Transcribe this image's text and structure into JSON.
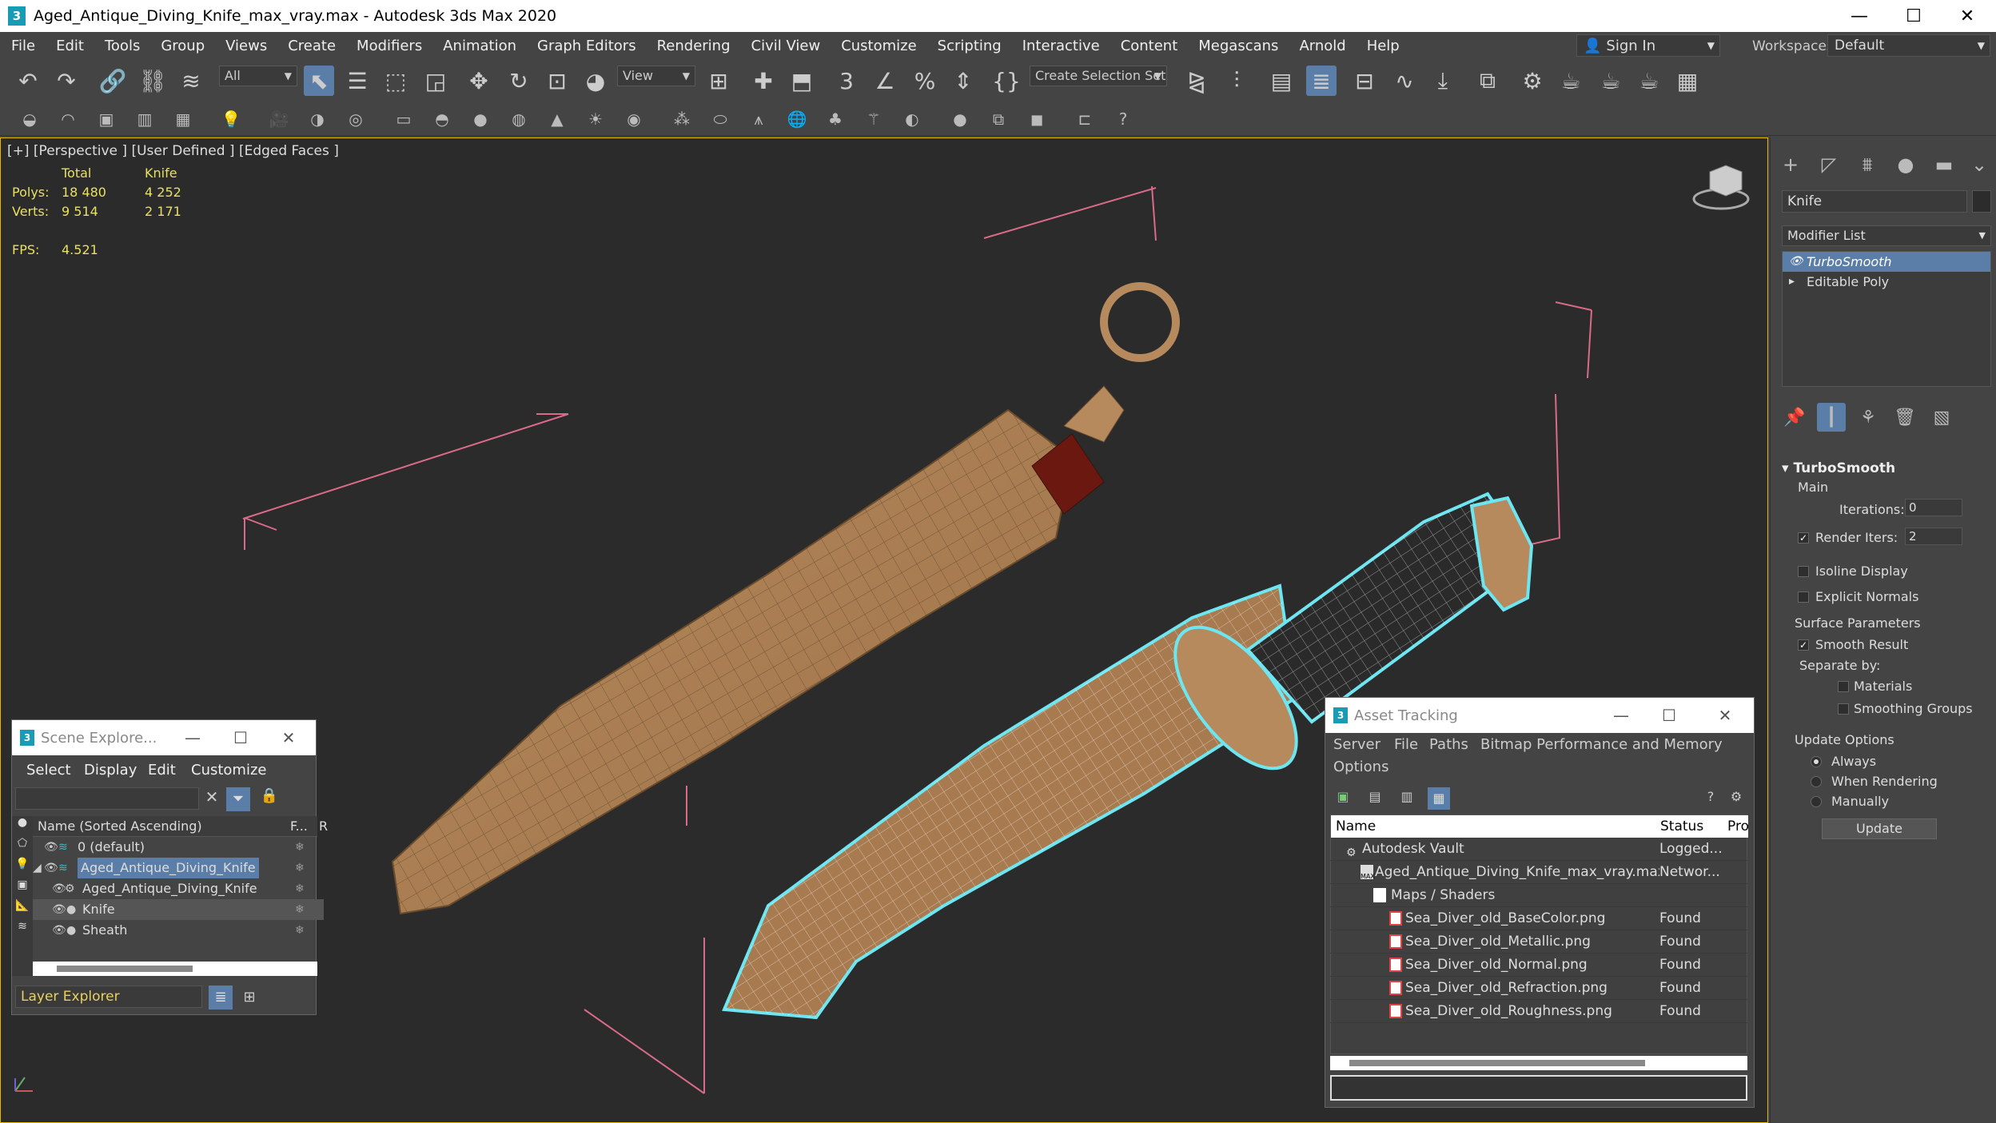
{
  "window": {
    "title": "Aged_Antique_Diving_Knife_max_vray.max - Autodesk 3ds Max 2020",
    "logo": "3",
    "minimize": "—",
    "maximize": "☐",
    "close": "✕"
  },
  "menu": [
    "File",
    "Edit",
    "Tools",
    "Group",
    "Views",
    "Create",
    "Modifiers",
    "Animation",
    "Graph Editors",
    "Rendering",
    "Civil View",
    "Customize",
    "Scripting",
    "Interactive",
    "Content",
    "Megascans",
    "Arnold",
    "Help"
  ],
  "signin": {
    "label": "Sign In",
    "icon": "user-icon"
  },
  "workspaces": {
    "label": "Workspaces:",
    "value": "Default"
  },
  "toolbar": {
    "filter_value": "All",
    "view_value": "View",
    "selection_set": "Create Selection Set"
  },
  "viewport": {
    "label": "[+] [Perspective ] [User Defined ] [Edged Faces ]",
    "stats": {
      "col_total": "Total",
      "col_knife": "Knife",
      "polys_label": "Polys:",
      "polys_total": "18 480",
      "polys_knife": "4 252",
      "verts_label": "Verts:",
      "verts_total": "9 514",
      "verts_knife": "2 171",
      "fps_label": "FPS:",
      "fps_value": "4.521"
    }
  },
  "command_panel": {
    "object_name": "Knife",
    "modifier_list": "Modifier List",
    "stack": [
      "TurboSmooth",
      "Editable Poly"
    ],
    "rollout": "TurboSmooth",
    "main": "Main",
    "iterations_label": "Iterations:",
    "iterations_value": "0",
    "render_iters_label": "Render Iters:",
    "render_iters_value": "2",
    "isoline": "Isoline Display",
    "explicit_normals": "Explicit Normals",
    "surface_params": "Surface Parameters",
    "smooth_result": "Smooth Result",
    "separate_by": "Separate by:",
    "materials": "Materials",
    "smoothing_groups": "Smoothing Groups",
    "update_options": "Update Options",
    "always": "Always",
    "when_rendering": "When Rendering",
    "manually": "Manually",
    "update_button": "Update"
  },
  "scene_explorer": {
    "title": "Scene Explore...",
    "menu": [
      "Select",
      "Display",
      "Edit",
      "Customize"
    ],
    "col_name": "Name (Sorted Ascending)",
    "col_f": "F...",
    "col_r": "R",
    "rows": [
      "0 (default)",
      "Aged_Antique_Diving_Knife",
      "Aged_Antique_Diving_Knife",
      "Knife",
      "Sheath"
    ],
    "footer": "Layer Explorer"
  },
  "asset_tracking": {
    "title": "Asset Tracking",
    "menu": [
      "Server",
      "File",
      "Paths",
      "Bitmap Performance and Memory",
      "Options"
    ],
    "col_name": "Name",
    "col_status": "Status",
    "col_pro": "Pro",
    "rows": [
      {
        "name": "Autodesk Vault",
        "status": "Logged..."
      },
      {
        "name": "Aged_Antique_Diving_Knife_max_vray.max",
        "status": "Networ..."
      },
      {
        "name": "Maps / Shaders",
        "status": ""
      },
      {
        "name": "Sea_Diver_old_BaseColor.png",
        "status": "Found"
      },
      {
        "name": "Sea_Diver_old_Metallic.png",
        "status": "Found"
      },
      {
        "name": "Sea_Diver_old_Normal.png",
        "status": "Found"
      },
      {
        "name": "Sea_Diver_old_Refraction.png",
        "status": "Found"
      },
      {
        "name": "Sea_Diver_old_Roughness.png",
        "status": "Found"
      }
    ]
  }
}
